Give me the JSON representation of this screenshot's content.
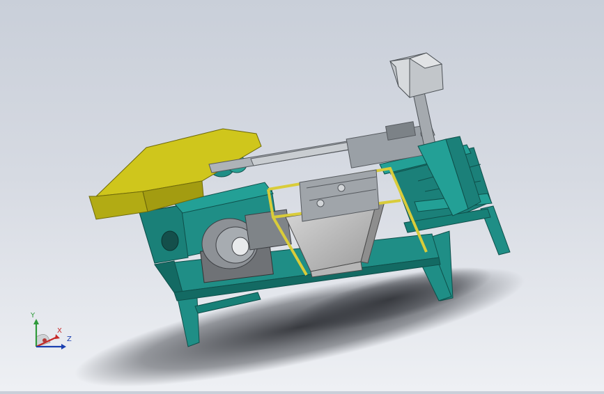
{
  "viewport": {
    "colors": {
      "frame": "#1f8e86",
      "frame_dark": "#136a63",
      "cover": "#c9c219",
      "cover_dark": "#9e9810",
      "steel": "#9aa0a6",
      "steel_light": "#c4c8cc",
      "rail_yellow": "#d9cc3a"
    }
  },
  "triad": {
    "x_label": "X",
    "y_label": "Y",
    "z_label": "Z",
    "colors": {
      "x": "#c62828",
      "y": "#2e9a3a",
      "z": "#1a3fb0"
    }
  }
}
